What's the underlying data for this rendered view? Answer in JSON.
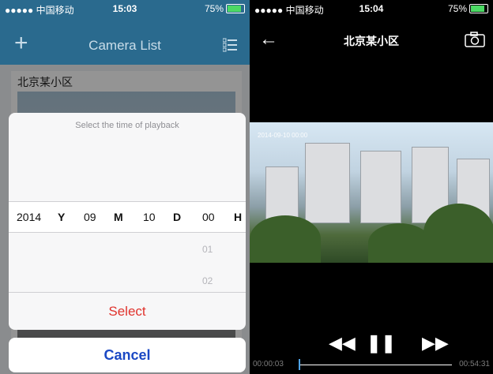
{
  "left": {
    "status": {
      "carrier": "●●●●● 中国移动 ",
      "time": "15:03",
      "battery": "75%"
    },
    "header": {
      "title": "Camera List",
      "add": "+"
    },
    "camera": {
      "name": "北京某小区"
    },
    "picker": {
      "title": "Select the time of playback",
      "year": "2014",
      "year_unit": "Y",
      "month": "09",
      "month_unit": "M",
      "day": "10",
      "day_unit": "D",
      "hour": "00",
      "hour_unit": "H",
      "hour_next1": "01",
      "hour_next2": "02",
      "select_label": "Select"
    },
    "cancel_label": "Cancel"
  },
  "right": {
    "status": {
      "carrier": "●●●●● 中国移动 ",
      "time": "15:04",
      "battery": "75%"
    },
    "header": {
      "title": "北京某小区",
      "back": "←"
    },
    "video": {
      "timestamp": "2014-09-10 00:00"
    },
    "controls": {
      "rewind": "◀◀",
      "pause": "❚❚",
      "forward": "▶▶"
    },
    "timebar": {
      "current": "00:00:03",
      "total": "00:54:31",
      "progress": 0.001
    }
  },
  "colors": {
    "header_blue": "#2a6a8e",
    "select_red": "#e0332d",
    "cancel_blue": "#1a48c4",
    "progress_blue": "#4ea3e6"
  }
}
